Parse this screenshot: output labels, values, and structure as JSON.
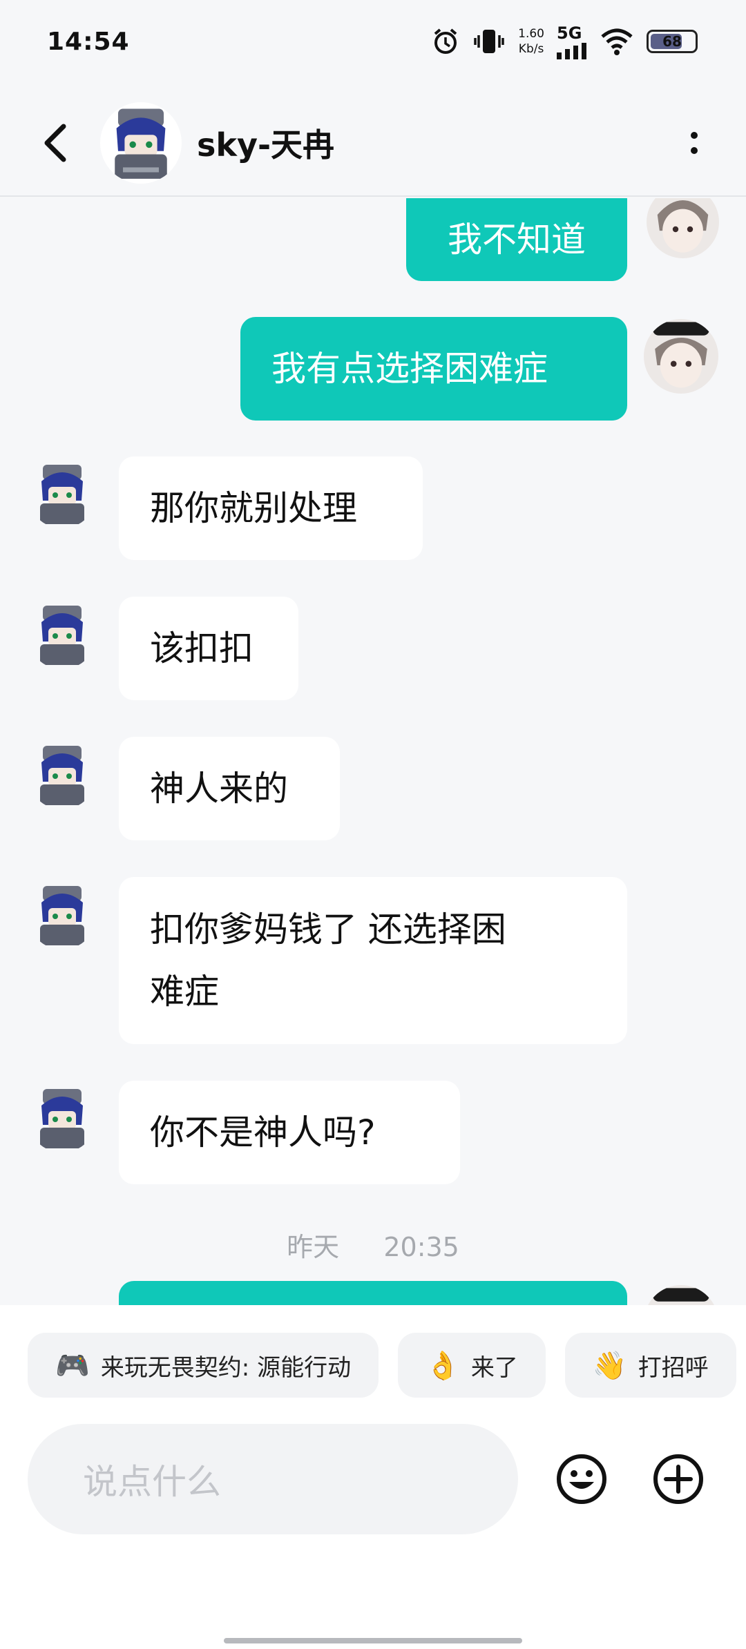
{
  "status_bar": {
    "time": "14:54",
    "speed_value": "1.60",
    "speed_unit": "Kb/s",
    "network": "5G",
    "battery": "68"
  },
  "header": {
    "contact_name": "sky-天冉"
  },
  "messages": [
    {
      "side": "me",
      "text": "我不知道"
    },
    {
      "side": "me",
      "text": "我有点选择困难症"
    },
    {
      "side": "them",
      "text": "那你就别处理"
    },
    {
      "side": "them",
      "text": "该扣扣"
    },
    {
      "side": "them",
      "text": "神人来的"
    },
    {
      "side": "them",
      "line1": "扣你爹妈钱了 还选择困",
      "line2": "难症"
    },
    {
      "side": "them",
      "text": "你不是神人吗?"
    }
  ],
  "time_divider": {
    "day": "昨天",
    "time": "20:35"
  },
  "quick_replies": [
    {
      "emoji": "🎮",
      "label": "来玩无畏契约: 源能行动"
    },
    {
      "emoji": "👌",
      "label": "来了"
    },
    {
      "emoji": "👋",
      "label": "打招呼"
    }
  ],
  "composer": {
    "placeholder": "说点什么"
  },
  "colors": {
    "accent": "#0fc8b8",
    "background": "#f6f7f9",
    "bubble_them": "#ffffff"
  }
}
